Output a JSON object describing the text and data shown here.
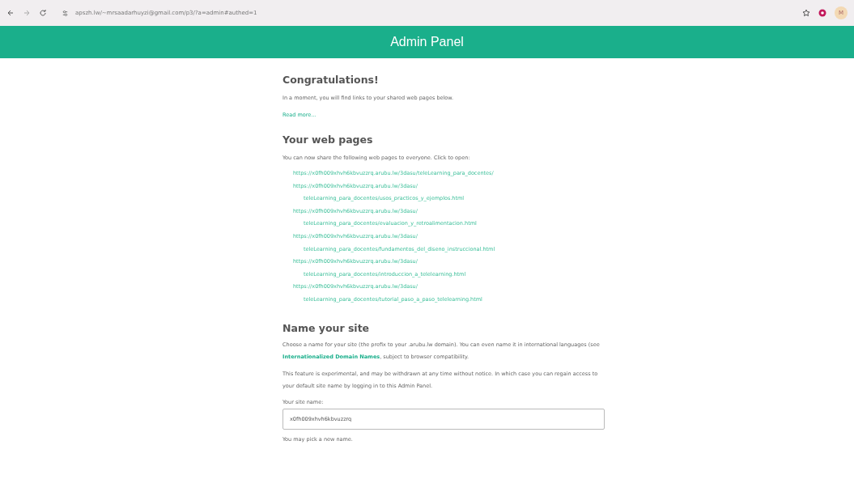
{
  "browser": {
    "url": "apszh.lw/~mrsaadarhuyzi@gmail.com/p3/?a=admin#authed=1",
    "profile": "M"
  },
  "header": {
    "title": "Admin Panel"
  },
  "intro": {
    "heading": "Congratulations!",
    "text": "In a moment, you will find links to your shared web pages below.",
    "read_more": "Read more..."
  },
  "pages": {
    "heading": "Your web pages",
    "text": "You can now share the following web pages to everyone. Click to open:",
    "links": [
      {
        "start": "https://x0fh009xhvh6kbvuzzrq.arubu.lw/3dasu/teleLearning_para_docentes/"
      },
      {
        "start": "https://x0fh009xhvh6kbvuzzrq.arubu.lw/3dasu/",
        "end": "teleLearning_para_docentes/usos_practicos_y_ejemplos.html"
      },
      {
        "start": "https://x0fh009xhvh6kbvuzzrq.arubu.lw/3dasu/",
        "end": "teleLearning_para_docentes/evaluacion_y_retroalimentacion.html"
      },
      {
        "start": "https://x0fh009xhvh6kbvuzzrq.arubu.lw/3dasu/",
        "end": "teleLearning_para_docentes/fundamentos_del_diseno_instruccional.html"
      },
      {
        "start": "https://x0fh009xhvh6kbvuzzrq.arubu.lw/3dasu/",
        "end": "teleLearning_para_docentes/introduccion_a_telelearning.html"
      },
      {
        "start": "https://x0fh009xhvh6kbvuzzrq.arubu.lw/3dasu/",
        "end": "teleLearning_para_docentes/tutorial_paso_a_paso_telelearning.html"
      }
    ]
  },
  "site": {
    "heading": "Name your site",
    "text_before": "Choose a name for your site (the prefix to your .arubu.lw domain). You can even name it in international languages (see",
    "idn_link": "Internationalized Domain Names",
    "text_after": ", subject to browser compatibility.",
    "note": "This feature is experimental, and may be withdrawn at any time without notice. In which case you can regain access to your default site name by logging in to this Admin Panel.",
    "field_label": "Your site name:",
    "field_value": "x0fh009xhvh6kbvuzzrq",
    "hint": "You may pick a new name."
  }
}
